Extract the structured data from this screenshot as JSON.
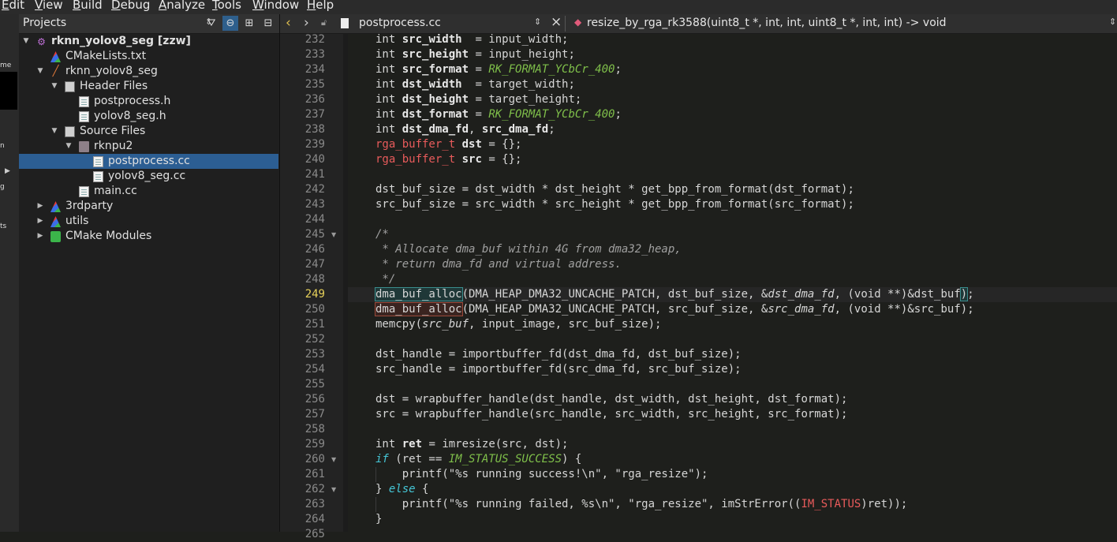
{
  "menu": [
    "Edit",
    "View",
    "Build",
    "Debug",
    "Analyze",
    "Tools",
    "Window",
    "Help"
  ],
  "modebar_fragments": [
    "me",
    "n",
    "g",
    "ts"
  ],
  "projects": {
    "title": "Projects",
    "tree": [
      {
        "label": "rknn_yolov8_seg [zzw]",
        "icon": "project-icon",
        "bold": true,
        "depth": 0,
        "arrow": "down"
      },
      {
        "label": "CMakeLists.txt",
        "icon": "cmake-icon",
        "depth": 1,
        "arrow": ""
      },
      {
        "label": "rknn_yolov8_seg",
        "icon": "hammer-icon",
        "depth": 1,
        "arrow": "down"
      },
      {
        "label": "Header Files",
        "icon": "header-folder-icon",
        "depth": 2,
        "arrow": "down"
      },
      {
        "label": "postprocess.h",
        "icon": "file-icon",
        "depth": 3,
        "arrow": ""
      },
      {
        "label": "yolov8_seg.h",
        "icon": "file-icon",
        "depth": 3,
        "arrow": ""
      },
      {
        "label": "Source Files",
        "icon": "source-folder-icon",
        "depth": 2,
        "arrow": "down"
      },
      {
        "label": "rknpu2",
        "icon": "folder-icon",
        "depth": 3,
        "arrow": "down"
      },
      {
        "label": "postprocess.cc",
        "icon": "file-icon",
        "depth": 4,
        "arrow": "",
        "selected": true
      },
      {
        "label": "yolov8_seg.cc",
        "icon": "file-icon",
        "depth": 4,
        "arrow": ""
      },
      {
        "label": "main.cc",
        "icon": "file-icon",
        "depth": 3,
        "arrow": ""
      },
      {
        "label": "3rdparty",
        "icon": "cmake-icon",
        "depth": 1,
        "arrow": "right"
      },
      {
        "label": "utils",
        "icon": "cmake-icon",
        "depth": 1,
        "arrow": "right"
      },
      {
        "label": "CMake Modules",
        "icon": "cmake-modules-icon",
        "depth": 1,
        "arrow": "right"
      }
    ]
  },
  "editor": {
    "filename": "postprocess.cc",
    "function_signature": "resize_by_rga_rk3588(uint8_t *, int, int, uint8_t *, int, int) -> void",
    "current_line": 249,
    "lines": [
      {
        "n": 232,
        "html": "<span class='k'>int</span> <span class='b'>src_width</span>  = input_width;"
      },
      {
        "n": 233,
        "html": "<span class='k'>int</span> <span class='b'>src_height</span> = input_height;"
      },
      {
        "n": 234,
        "html": "<span class='k'>int</span> <span class='b'>src_format</span> = <span class='en'>RK_FORMAT_YCbCr_400</span>;"
      },
      {
        "n": 235,
        "html": "<span class='k'>int</span> <span class='b'>dst_width</span>  = target_width;"
      },
      {
        "n": 236,
        "html": "<span class='k'>int</span> <span class='b'>dst_height</span> = target_height;"
      },
      {
        "n": 237,
        "html": "<span class='k'>int</span> <span class='b'>dst_format</span> = <span class='en'>RK_FORMAT_YCbCr_400</span>;"
      },
      {
        "n": 238,
        "html": "<span class='k'>int</span> <span class='b'>dst_dma_fd</span>, <span class='b'>src_dma_fd</span>;"
      },
      {
        "n": 239,
        "html": "<span class='ty'>rga_buffer_t</span> <span class='b'>dst</span> = {};"
      },
      {
        "n": 240,
        "html": "<span class='ty'>rga_buffer_t</span> <span class='b'>src</span> = {};"
      },
      {
        "n": 241,
        "html": ""
      },
      {
        "n": 242,
        "html": "dst_buf_size = dst_width * dst_height * get_bpp_from_format(dst_format);"
      },
      {
        "n": 243,
        "html": "src_buf_size = src_width * src_height * get_bpp_from_format(src_format);"
      },
      {
        "n": 244,
        "html": ""
      },
      {
        "n": 245,
        "html": "<span class='cm'>/*</span>",
        "fold": true
      },
      {
        "n": 246,
        "html": "<span class='cm'> * Allocate dma_buf within 4G from dma32_heap,</span>"
      },
      {
        "n": 247,
        "html": "<span class='cm'> * return dma_fd and virtual address.</span>"
      },
      {
        "n": 248,
        "html": "<span class='cm'> */</span>"
      },
      {
        "n": 249,
        "html": "<span class='hl1'>dma_buf_alloc</span>(DMA_HEAP_DMA32_UNCACHE_PATCH, dst_buf_size, &amp;<span class='it'>dst_dma_fd</span>, (<span class='k'>void</span> **)&amp;dst_buf<span class='hl1'>)</span>;"
      },
      {
        "n": 250,
        "html": "<span class='hl2'>dma_buf_alloc</span>(DMA_HEAP_DMA32_UNCACHE_PATCH, src_buf_size, &amp;<span class='it'>src_dma_fd</span>, (<span class='k'>void</span> **)&amp;src_buf);"
      },
      {
        "n": 251,
        "html": "memcpy(<span class='it'>src_buf</span>, input_image, src_buf_size);"
      },
      {
        "n": 252,
        "html": ""
      },
      {
        "n": 253,
        "html": "dst_handle = importbuffer_fd(dst_dma_fd, dst_buf_size);"
      },
      {
        "n": 254,
        "html": "src_handle = importbuffer_fd(src_dma_fd, src_buf_size);"
      },
      {
        "n": 255,
        "html": ""
      },
      {
        "n": 256,
        "html": "dst = wrapbuffer_handle(dst_handle, dst_width, dst_height, dst_format);"
      },
      {
        "n": 257,
        "html": "src = wrapbuffer_handle(src_handle, src_width, src_height, src_format);"
      },
      {
        "n": 258,
        "html": ""
      },
      {
        "n": 259,
        "html": "<span class='k'>int</span> <span class='b'>ret</span> = imresize(src, dst);"
      },
      {
        "n": 260,
        "html": "<span class='kw'>if</span> (ret == <span class='en'>IM_STATUS_SUCCESS</span>) {",
        "fold": true
      },
      {
        "n": 261,
        "html": "    printf(\"%s running success!\\n\", \"rga_resize\");"
      },
      {
        "n": 262,
        "html": "} <span class='kw'>else</span> {",
        "fold": true
      },
      {
        "n": 263,
        "html": "    printf(\"%s running failed, %s\\n\", \"rga_resize\", imStrError((<span class='ty'>IM_STATUS</span>)ret));"
      },
      {
        "n": 264,
        "html": "}"
      },
      {
        "n": 265,
        "html": ""
      }
    ]
  }
}
